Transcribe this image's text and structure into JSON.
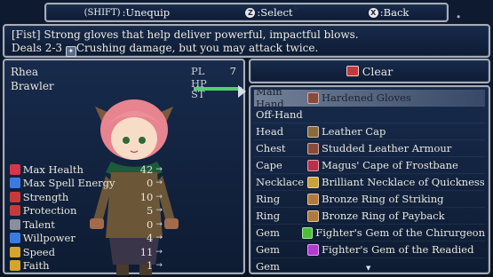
{
  "controls": {
    "unequip_key": "(SHIFT)",
    "unequip_label": ":Unequip",
    "select_key": "Z",
    "select_label": ":Select",
    "back_key": "X",
    "back_label": ":Back"
  },
  "description": {
    "line1": "[Fist] Strong gloves that help deliver powerful, impactful blows.",
    "line2_prefix": "Deals 2-3",
    "damage_type": "Crushing",
    "line2_suffix": "damage, but you may attack twice."
  },
  "character": {
    "name": "Rhea",
    "class": "Brawler",
    "pl_label": "PL",
    "pl_value": "7",
    "hp_label": "HP",
    "hp_fraction": 1.0,
    "st_label": "ST",
    "stats": [
      {
        "label": "Max Health",
        "value": "42",
        "icon": "heart-icon",
        "color": "#d8354a"
      },
      {
        "label": "Max Spell Energy",
        "value": "0",
        "icon": "spell-icon",
        "color": "#3a7be0"
      },
      {
        "label": "Strength",
        "value": "10",
        "icon": "strength-icon",
        "color": "#c73a3a"
      },
      {
        "label": "Protection",
        "value": "5",
        "icon": "shield-icon",
        "color": "#c73a3a"
      },
      {
        "label": "Talent",
        "value": "0",
        "icon": "talent-icon",
        "color": "#8a8fa0"
      },
      {
        "label": "Willpower",
        "value": "4",
        "icon": "willpower-icon",
        "color": "#3a7be0"
      },
      {
        "label": "Speed",
        "value": "11",
        "icon": "speed-icon",
        "color": "#d4a52a"
      },
      {
        "label": "Faith",
        "value": "1",
        "icon": "faith-icon",
        "color": "#d4a52a"
      }
    ]
  },
  "clear_label": "Clear",
  "equipment": [
    {
      "slot": "Main Hand",
      "item": "Hardened Gloves",
      "icon": "gloves-icon",
      "color": "#8a4a3a",
      "selected": true
    },
    {
      "slot": "Off-Hand",
      "item": "",
      "icon": "",
      "color": "",
      "selected": false
    },
    {
      "slot": "Head",
      "item": "Leather Cap",
      "icon": "cap-icon",
      "color": "#8a6a3a",
      "selected": false
    },
    {
      "slot": "Chest",
      "item": "Studded Leather Armour",
      "icon": "armour-icon",
      "color": "#8a4a3a",
      "selected": false
    },
    {
      "slot": "Cape",
      "item": "Magus' Cape of Frostbane",
      "icon": "cape-icon",
      "color": "#b8304a",
      "selected": false
    },
    {
      "slot": "Necklace",
      "item": "Brilliant Necklace of Quickness",
      "icon": "necklace-icon",
      "color": "#c9a13a",
      "selected": false
    },
    {
      "slot": "Ring",
      "item": "Bronze Ring of Striking",
      "icon": "ring-icon",
      "color": "#b07a3a",
      "selected": false
    },
    {
      "slot": "Ring",
      "item": "Bronze Ring of Payback",
      "icon": "ring-icon",
      "color": "#b07a3a",
      "selected": false
    },
    {
      "slot": "Gem",
      "item": "Fighter's Gem of the Chirurgeon",
      "icon": "gem-icon",
      "color": "#4bbf3a",
      "selected": false
    },
    {
      "slot": "Gem",
      "item": "Fighter's Gem of the Readied",
      "icon": "gem-icon",
      "color": "#b23ad0",
      "selected": false
    },
    {
      "slot": "Gem",
      "item": "",
      "icon": "",
      "color": "",
      "selected": false
    }
  ]
}
